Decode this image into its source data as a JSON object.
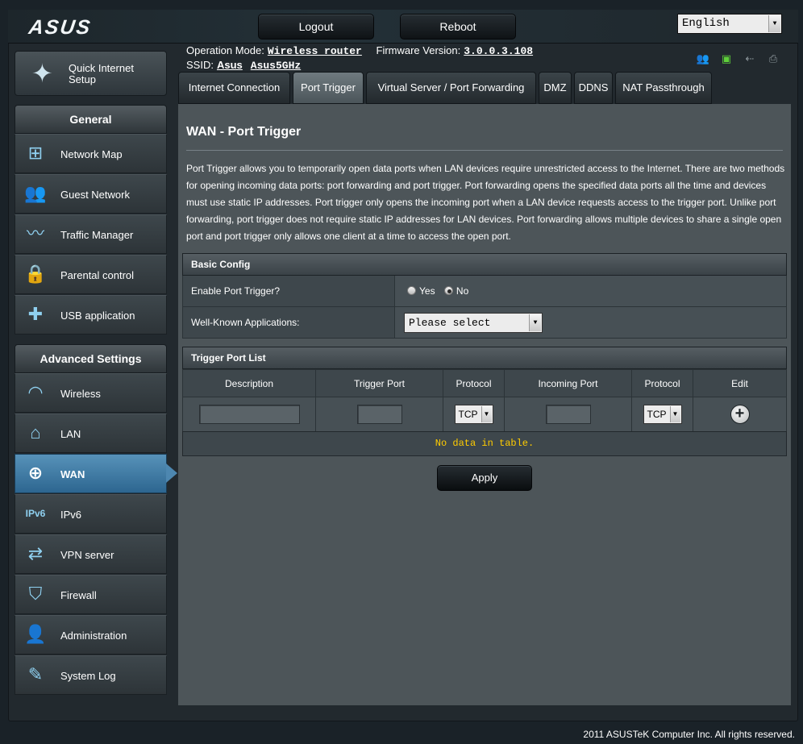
{
  "brand": {
    "logo": "ASUS"
  },
  "header": {
    "logout_label": "Logout",
    "reboot_label": "Reboot",
    "language": "English"
  },
  "info": {
    "operation_mode_label": "Operation Mode:",
    "operation_mode": "Wireless router",
    "firmware_label": "Firmware Version:",
    "firmware": "3.0.0.3.108",
    "ssid_label": "SSID:",
    "ssid_1": "Asus",
    "ssid_2": "Asus5GHz"
  },
  "status_icons": [
    "clients-icon",
    "network-icon",
    "usb-icon",
    "printer-icon"
  ],
  "sidebar": {
    "quick_setup": "Quick Internet Setup",
    "general_header": "General",
    "general_items": [
      {
        "label": "Network Map",
        "icon": "network-map-icon"
      },
      {
        "label": "Guest Network",
        "icon": "guest-network-icon"
      },
      {
        "label": "Traffic Manager",
        "icon": "traffic-manager-icon"
      },
      {
        "label": "Parental control",
        "icon": "lock-icon"
      },
      {
        "label": "USB application",
        "icon": "puzzle-icon"
      }
    ],
    "advanced_header": "Advanced Settings",
    "advanced_items": [
      {
        "label": "Wireless",
        "icon": "wifi-icon"
      },
      {
        "label": "LAN",
        "icon": "home-icon"
      },
      {
        "label": "WAN",
        "icon": "globe-icon",
        "active": true
      },
      {
        "label": "IPv6",
        "icon": "ipv6-icon"
      },
      {
        "label": "VPN server",
        "icon": "vpn-icon"
      },
      {
        "label": "Firewall",
        "icon": "shield-icon"
      },
      {
        "label": "Administration",
        "icon": "user-icon"
      },
      {
        "label": "System Log",
        "icon": "edit-log-icon"
      }
    ]
  },
  "tabs": [
    {
      "label": "Internet Connection"
    },
    {
      "label": "Port Trigger",
      "active": true
    },
    {
      "label": "Virtual Server / Port Forwarding"
    },
    {
      "label": "DMZ"
    },
    {
      "label": "DDNS"
    },
    {
      "label": "NAT Passthrough"
    }
  ],
  "main": {
    "title": "WAN - Port Trigger",
    "description": "Port Trigger allows you to temporarily open data ports when LAN devices require unrestricted access to the Internet. There are two methods for opening incoming data ports: port forwarding and port trigger. Port forwarding opens the specified data ports all the time and devices must use static IP addresses. Port trigger only opens the incoming port when a LAN device requests access to the trigger port. Unlike port forwarding, port trigger does not require static IP addresses for LAN devices. Port forwarding allows multiple devices to share a single open port and port trigger only allows one client at a time to access the open port.",
    "basic_config": {
      "header": "Basic Config",
      "enable_label": "Enable Port Trigger?",
      "yes_label": "Yes",
      "no_label": "No",
      "enabled": "No",
      "apps_label": "Well-Known Applications:",
      "apps_value": "Please select"
    },
    "trigger_list": {
      "header": "Trigger Port List",
      "columns": [
        "Description",
        "Trigger Port",
        "Protocol",
        "Incoming Port",
        "Protocol",
        "Edit"
      ],
      "trigger_protocol": "TCP",
      "incoming_protocol": "TCP",
      "empty_message": "No data in table."
    },
    "apply_label": "Apply"
  },
  "footer": {
    "copyright": "2011 ASUSTeK Computer Inc. All rights reserved."
  }
}
